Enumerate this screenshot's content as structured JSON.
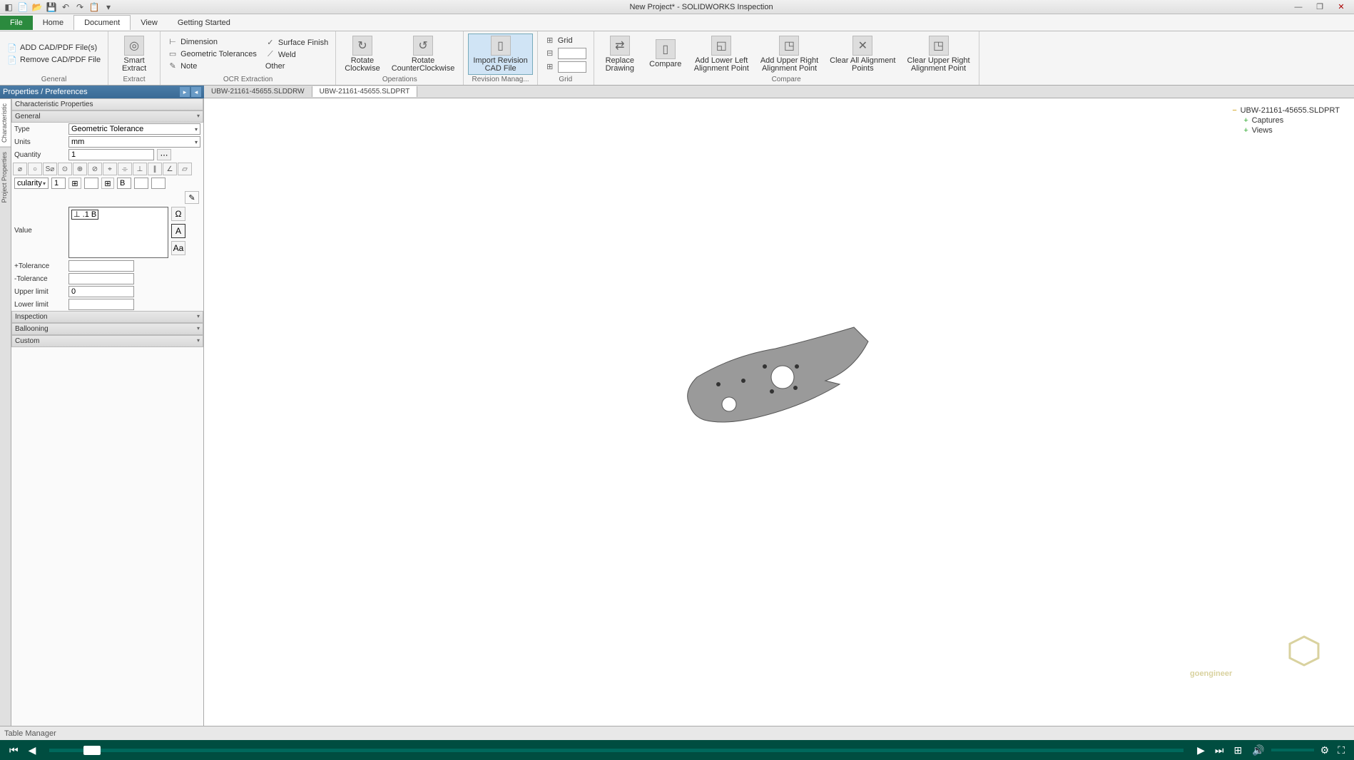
{
  "titlebar": {
    "title": "New Project* - SOLIDWORKS Inspection"
  },
  "menu": {
    "file": "File",
    "home": "Home",
    "document": "Document",
    "view": "View",
    "getting_started": "Getting Started"
  },
  "ribbon": {
    "general": {
      "add_cad": "ADD CAD/PDF File(s)",
      "remove_cad": "Remove CAD/PDF File",
      "label": "General"
    },
    "extract": {
      "smart_extract": "Smart\nExtract",
      "label": "Extract"
    },
    "ocr": {
      "dimension": "Dimension",
      "geom_tol": "Geometric Tolerances",
      "note": "Note",
      "surface_finish": "Surface Finish",
      "weld": "Weld",
      "other": "Other",
      "label": "OCR Extraction"
    },
    "operations": {
      "rotate_cw": "Rotate\nClockwise",
      "rotate_ccw": "Rotate\nCounterClockwise",
      "label": "Operations"
    },
    "revision": {
      "import_rev": "Import Revision\nCAD File",
      "label": "Revision Manag..."
    },
    "grid": {
      "grid": "Grid",
      "label": "Grid"
    },
    "compare": {
      "replace": "Replace\nDrawing",
      "compare": "Compare",
      "add_ll": "Add Lower Left\nAlignment Point",
      "add_ur": "Add Upper Right\nAlignment Point",
      "clear_all": "Clear All Alignment\nPoints",
      "clear_ur": "Clear Upper Right\nAlignment Point",
      "label": "Compare"
    }
  },
  "panel_header": "Properties / Preferences",
  "doctabs": {
    "tab1": "UBW-21161-45655.SLDDRW",
    "tab2": "UBW-21161-45655.SLDPRT"
  },
  "sidetabs": {
    "char": "Characteristic",
    "proj": "Project Properties"
  },
  "props": {
    "header": "Characteristic Properties",
    "general": "General",
    "type_label": "Type",
    "type_value": "Geometric Tolerance",
    "units_label": "Units",
    "units_value": "mm",
    "quantity_label": "Quantity",
    "quantity_value": "1",
    "cularity": "cularity",
    "one": "1",
    "b": "B",
    "value_label": "Value",
    "value_content": "⊥ .1 B",
    "plus_tol": "+Tolerance",
    "minus_tol": "-Tolerance",
    "upper_limit": "Upper limit",
    "upper_limit_val": "0",
    "lower_limit": "Lower limit",
    "inspection": "Inspection",
    "ballooning": "Ballooning",
    "custom": "Custom"
  },
  "tree": {
    "root": "UBW-21161-45655.SLDPRT",
    "captures": "Captures",
    "views": "Views"
  },
  "status": "Table Manager",
  "logo": "goengineer"
}
